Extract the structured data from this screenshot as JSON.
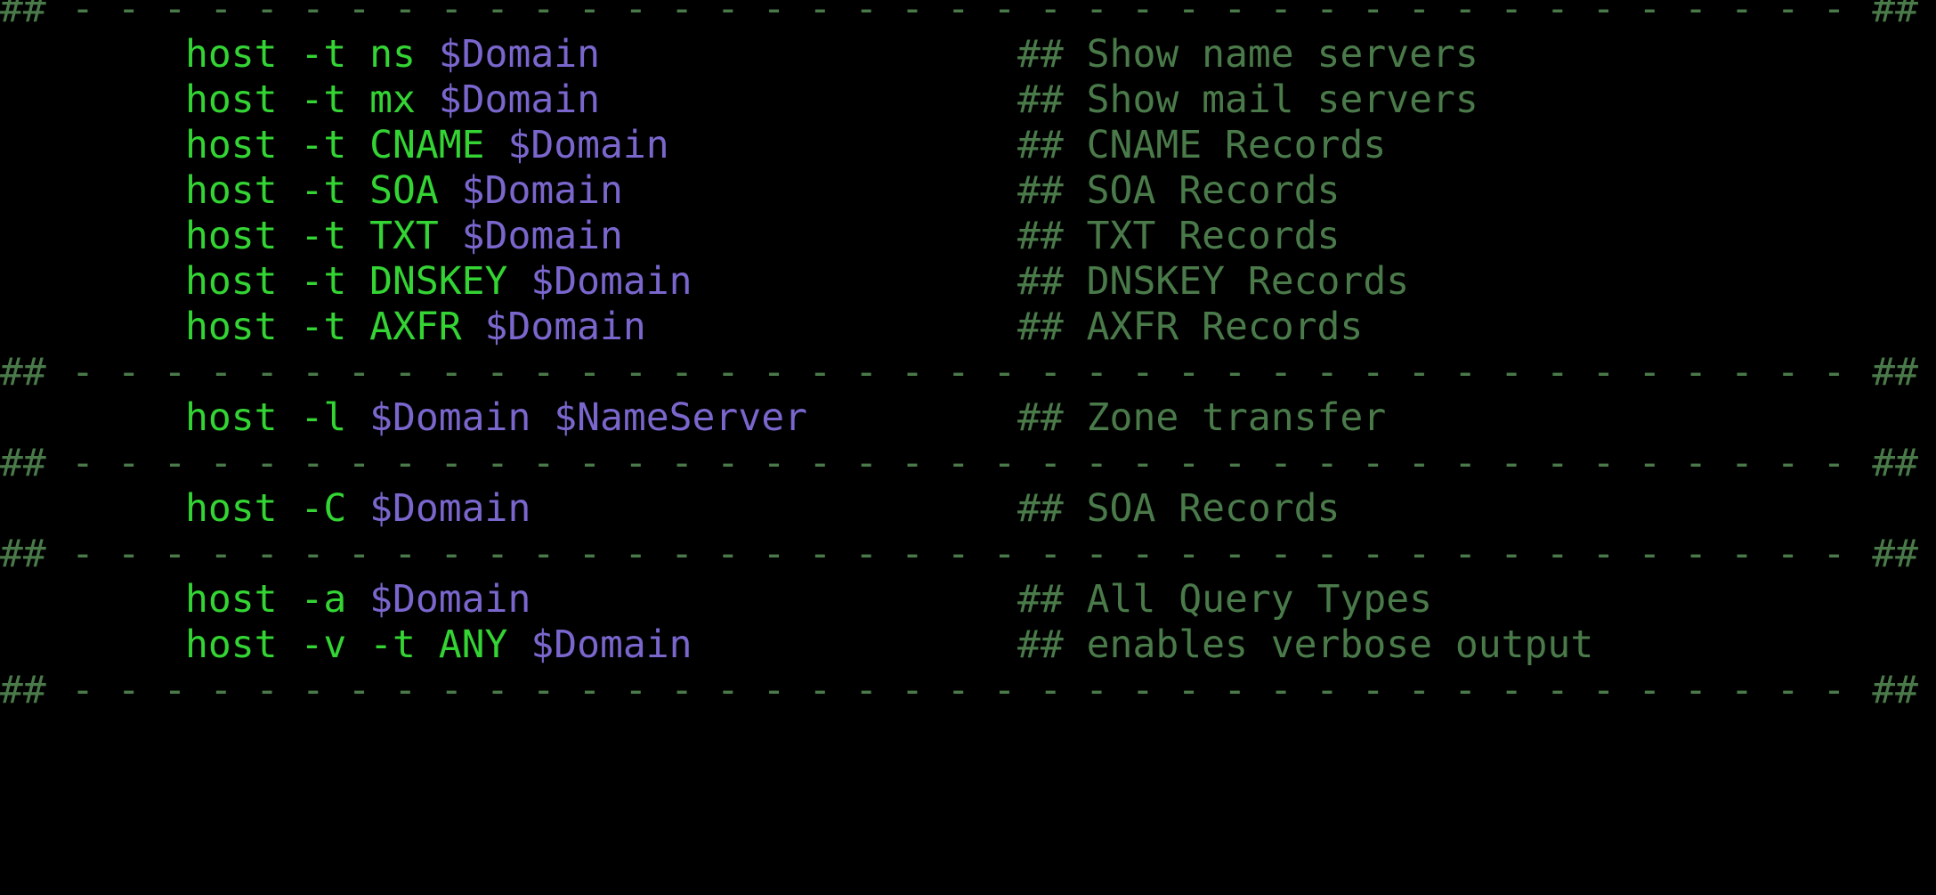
{
  "separator": {
    "left": "##",
    "right": "##",
    "dashes": "- - - - - - - - - - - - - - - - - - - - - - - - - - - - - - - - - - - - - - - - - - - - - - - - - - - - - - - - - - - - - - - - - - - - - - - - - - - - - - - - - - - - - - - - - - - - - - - - - - - - - - - - - - - - - - - - - - - - - - - - - - - - - - - - - - - - - - - - - - - -"
  },
  "colors": {
    "background": "#000000",
    "command": "#33d433",
    "variable": "#7a66cc",
    "comment": "#4a7a4a"
  },
  "blocks": [
    {
      "rows": [
        {
          "cmd": "host -t ns ",
          "vars": "$Domain",
          "comment": "## Show name servers"
        },
        {
          "cmd": "host -t mx ",
          "vars": "$Domain",
          "comment": "## Show mail servers"
        },
        {
          "cmd": "host -t CNAME ",
          "vars": "$Domain",
          "comment": "## CNAME Records"
        },
        {
          "cmd": "host -t SOA ",
          "vars": "$Domain",
          "comment": "## SOA Records"
        },
        {
          "cmd": "host -t TXT ",
          "vars": "$Domain",
          "comment": "## TXT Records"
        },
        {
          "cmd": "host -t DNSKEY ",
          "vars": "$Domain",
          "comment": "## DNSKEY Records"
        },
        {
          "cmd": "host -t AXFR ",
          "vars": "$Domain",
          "comment": "## AXFR Records"
        }
      ]
    },
    {
      "rows": [
        {
          "cmd": "host -l ",
          "vars": "$Domain $NameServer",
          "comment": "## Zone transfer"
        }
      ]
    },
    {
      "rows": [
        {
          "cmd": "host -C ",
          "vars": "$Domain",
          "comment": "## SOA Records"
        }
      ]
    },
    {
      "rows": [
        {
          "cmd": "host -a ",
          "vars": "$Domain",
          "comment": "## All Query Types"
        },
        {
          "cmd": "host -v -t ANY ",
          "vars": "$Domain",
          "comment": "## enables verbose output"
        }
      ]
    }
  ]
}
